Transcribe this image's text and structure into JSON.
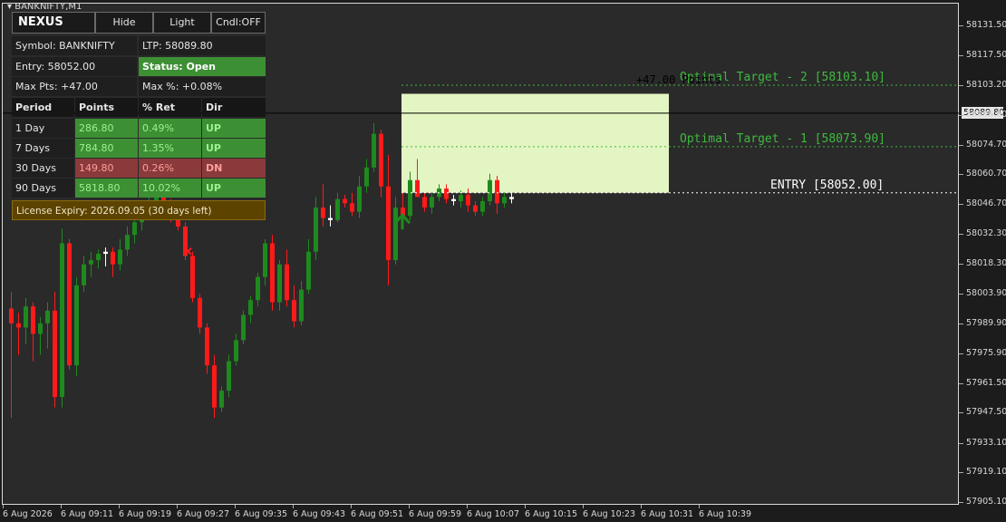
{
  "window": {
    "symbol_title": "BANKNIFTY,M1"
  },
  "panel": {
    "brand": "NEXUS",
    "buttons": {
      "hide": "Hide",
      "light": "Light",
      "cndl": "Cndl:OFF"
    },
    "symbol": "Symbol: BANKNIFTY",
    "ltp": "LTP: 58089.80",
    "entry": "Entry: 58052.00",
    "status": "Status: Open",
    "max_pts": "Max Pts: +47.00",
    "max_pct": "Max %:  +0.08%",
    "table_headers": [
      "Period",
      "Points",
      "% Ret",
      "Dir"
    ],
    "rows": [
      {
        "period": "1 Day",
        "points": "286.80",
        "ret": "0.49%",
        "dir": "UP",
        "up": true
      },
      {
        "period": "7 Days",
        "points": "784.80",
        "ret": "1.35%",
        "dir": "UP",
        "up": true
      },
      {
        "period": "30 Days",
        "points": "149.80",
        "ret": "0.26%",
        "dir": "DN",
        "up": false
      },
      {
        "period": "90 Days",
        "points": "5818.80",
        "ret": "10.02%",
        "dir": "UP",
        "up": true
      }
    ],
    "license": "License Expiry: 2026.09.05  (30 days left)"
  },
  "annotations": {
    "target2": "Optimal Target - 2 [58103.10]",
    "target1": "Optimal Target - 1 [58073.90]",
    "entry_label": "ENTRY [58052.00]",
    "max_points": "+47.00 Points"
  },
  "current_price_label": "58089.80",
  "colors": {
    "bull": "#1e8a1e",
    "bear": "#ff1a1a",
    "doji": "#ffffff",
    "zone": "#e3f5c2",
    "target_line": "#3dbb3d",
    "entry_line": "#ffffff"
  },
  "chart_data": {
    "type": "candlestick",
    "symbol": "BANKNIFTY",
    "timeframe": "M1",
    "y_ticks": [
      "58131.50",
      "58117.50",
      "58103.20",
      "58088.80",
      "58074.70",
      "58060.70",
      "58046.70",
      "58032.30",
      "58018.30",
      "58003.90",
      "57989.90",
      "57975.90",
      "57961.50",
      "57947.50",
      "57933.10",
      "57919.10",
      "57905.10"
    ],
    "ylim": [
      57904,
      58139
    ],
    "x_ticks": [
      "6 Aug 2026",
      "6 Aug 09:11",
      "6 Aug 09:19",
      "6 Aug 09:27",
      "6 Aug 09:35",
      "6 Aug 09:43",
      "6 Aug 09:51",
      "6 Aug 09:59",
      "6 Aug 10:07",
      "6 Aug 10:15",
      "6 Aug 10:23",
      "6 Aug 10:31",
      "6 Aug 10:39"
    ],
    "current_price": 58089.8,
    "entry": 58052.0,
    "target1": 58073.9,
    "target2": 58103.1,
    "zone_top": 58099.0,
    "signals": [
      {
        "type": "sell-cross",
        "price": 58024.0,
        "candle": 24
      },
      {
        "type": "buy-arrow",
        "price": 58038.0,
        "candle": 54
      }
    ],
    "candles": [
      [
        57997,
        58005,
        57945,
        57990
      ],
      [
        57990,
        57995,
        57975,
        57988
      ],
      [
        57988,
        58002,
        57980,
        57998
      ],
      [
        57998,
        58000,
        57972,
        57985
      ],
      [
        57985,
        57993,
        57975,
        57990
      ],
      [
        57990,
        58000,
        57978,
        57996
      ],
      [
        57996,
        58005,
        57950,
        57955
      ],
      [
        57955,
        58035,
        57950,
        58028
      ],
      [
        58028,
        58030,
        57968,
        57970
      ],
      [
        57970,
        58012,
        57965,
        58008
      ],
      [
        58008,
        58022,
        58005,
        58018
      ],
      [
        58018,
        58024,
        58012,
        58020
      ],
      [
        58020,
        58025,
        58016,
        58023
      ],
      [
        58023,
        58026,
        58017,
        58024
      ],
      [
        58024,
        58026,
        58012,
        58018
      ],
      [
        58018,
        58030,
        58015,
        58025
      ],
      [
        58025,
        58036,
        58022,
        58032
      ],
      [
        58032,
        58040,
        58028,
        58038
      ],
      [
        58038,
        58045,
        58034,
        58043
      ],
      [
        58043,
        58050,
        58040,
        58047
      ],
      [
        58047,
        58055,
        58042,
        58052
      ],
      [
        58052,
        58056,
        58040,
        58045
      ],
      [
        58045,
        58049,
        58038,
        58042
      ],
      [
        58042,
        58046,
        58034,
        58036
      ],
      [
        58036,
        58038,
        58020,
        58022
      ],
      [
        58022,
        58024,
        58000,
        58002
      ],
      [
        58002,
        58004,
        57985,
        57988
      ],
      [
        57988,
        57990,
        57966,
        57970
      ],
      [
        57970,
        57975,
        57945,
        57950
      ],
      [
        57950,
        57960,
        57948,
        57958
      ],
      [
        57958,
        57975,
        57955,
        57972
      ],
      [
        57972,
        57985,
        57970,
        57982
      ],
      [
        57982,
        57996,
        57980,
        57994
      ],
      [
        57994,
        58003,
        57990,
        58001
      ],
      [
        58001,
        58014,
        57998,
        58012
      ],
      [
        58012,
        58030,
        58008,
        58028
      ],
      [
        58028,
        58032,
        57996,
        58000
      ],
      [
        58000,
        58020,
        57996,
        58018
      ],
      [
        58018,
        58025,
        57998,
        58001
      ],
      [
        58001,
        58008,
        57988,
        57991
      ],
      [
        57991,
        58010,
        57989,
        58006
      ],
      [
        58006,
        58030,
        58004,
        58024
      ],
      [
        58024,
        58050,
        58020,
        58045
      ],
      [
        58045,
        58056,
        58036,
        58040
      ],
      [
        58040,
        58046,
        58036,
        58039
      ],
      [
        58039,
        58052,
        58038,
        58049
      ],
      [
        58049,
        58051,
        58045,
        58047
      ],
      [
        58047,
        58052,
        58041,
        58043
      ],
      [
        58043,
        58060,
        58040,
        58055
      ],
      [
        58055,
        58068,
        58052,
        58064
      ],
      [
        58064,
        58085,
        58062,
        58080
      ],
      [
        58080,
        58082,
        58050,
        58055
      ],
      [
        58055,
        58070,
        58008,
        58020
      ],
      [
        58020,
        58050,
        58018,
        58045
      ],
      [
        58045,
        58052,
        58038,
        58041
      ],
      [
        58041,
        58062,
        58039,
        58058
      ],
      [
        58058,
        58068,
        58055,
        58050
      ],
      [
        58050,
        58052,
        58043,
        58045
      ],
      [
        58045,
        58052,
        58042,
        58050
      ],
      [
        58050,
        58056,
        58048,
        58054
      ],
      [
        58054,
        58056,
        58047,
        58049
      ],
      [
        58049,
        58051,
        58046,
        58048
      ],
      [
        58048,
        58053,
        58045,
        58051
      ],
      [
        58051,
        58054,
        58043,
        58046
      ],
      [
        58046,
        58048,
        58041,
        58043
      ],
      [
        58043,
        58050,
        58041,
        58048
      ],
      [
        58048,
        58061,
        58046,
        58058
      ],
      [
        58058,
        58060,
        58042,
        58047
      ],
      [
        58047,
        58052,
        58045,
        58050
      ],
      [
        58050,
        58052,
        58047,
        58049
      ]
    ]
  }
}
